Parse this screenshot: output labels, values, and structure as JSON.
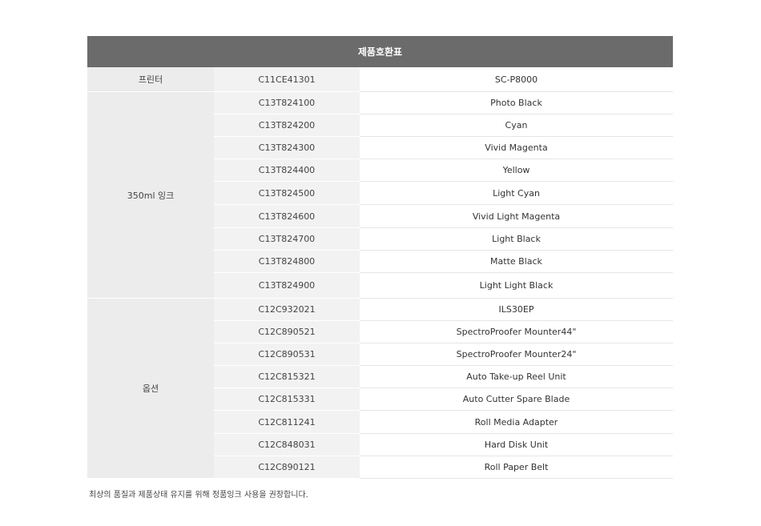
{
  "table": {
    "title": "제품호환표",
    "printer": {
      "label": "프린터",
      "code": "C11CE41301",
      "name": "SC-P8000"
    },
    "ink": {
      "label": "350ml 잉크",
      "rows": [
        {
          "code": "C13T824100",
          "name": "Photo Black"
        },
        {
          "code": "C13T824200",
          "name": "Cyan"
        },
        {
          "code": "C13T824300",
          "name": "Vivid Magenta"
        },
        {
          "code": "C13T824400",
          "name": "Yellow"
        },
        {
          "code": "C13T824500",
          "name": "Light Cyan"
        },
        {
          "code": "C13T824600",
          "name": "Vivid Light Magenta"
        },
        {
          "code": "C13T824700",
          "name": "Light Black"
        },
        {
          "code": "C13T824800",
          "name": "Matte Black"
        },
        {
          "code": "C13T824900",
          "name": "Light Light Black"
        }
      ]
    },
    "options": {
      "label": "옵션",
      "rows": [
        {
          "code": "C12C932021",
          "name": "ILS30EP"
        },
        {
          "code": "C12C890521",
          "name": "SpectroProofer Mounter44\""
        },
        {
          "code": "C12C890531",
          "name": "SpectroProofer Mounter24\""
        },
        {
          "code": "C12C815321",
          "name": "Auto Take-up Reel Unit"
        },
        {
          "code": "C12C815331",
          "name": "Auto Cutter Spare Blade"
        },
        {
          "code": "C12C811241",
          "name": "Roll Media Adapter"
        },
        {
          "code": "C12C848031",
          "name": "Hard Disk Unit"
        },
        {
          "code": "C12C890121",
          "name": "Roll Paper Belt"
        }
      ]
    }
  },
  "footnote": "최상의 품질과 제품상태 유지를 위해 정품잉크 사용을 권장합니다."
}
